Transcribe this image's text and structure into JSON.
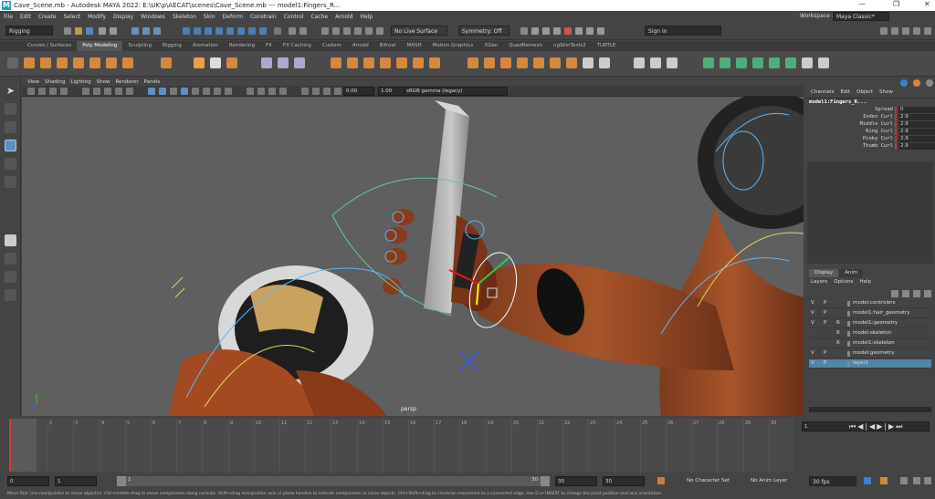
{
  "window": {
    "title": "Cave_Scene.mb - Autodesk MAYA 2022: E:\\UK\\p\\AECAT\\scenes\\Cave_Scene.mb  ---  model1:Fingers_R...",
    "workspace_label": "Workspace :",
    "workspace_value": "Maya Classic*"
  },
  "menu": [
    "File",
    "Edit",
    "Create",
    "Select",
    "Modify",
    "Display",
    "Windows",
    "Skeleton",
    "Skin",
    "Deform",
    "Constrain",
    "Control",
    "Cache",
    "Arnold",
    "Help"
  ],
  "statusline": {
    "menuset": "Rigging",
    "live_surface": "No Live Surface",
    "symmetry": "Symmetry: Off",
    "sign_in": "Sign In"
  },
  "shelf_tabs": [
    "Curves / Surfaces",
    "Poly Modeling",
    "Sculpting",
    "Rigging",
    "Animation",
    "Rendering",
    "FX",
    "FX Caching",
    "Custom",
    "Arnold",
    "Bifrost",
    "MASH",
    "Motion Graphics",
    "XGen",
    "QuadRemesh",
    "ngSkinTools2",
    "TURTLE"
  ],
  "shelf_active": "Poly Modeling",
  "panel_menu": [
    "View",
    "Shading",
    "Lighting",
    "Show",
    "Renderer",
    "Panels"
  ],
  "panel_toolbar": {
    "exposure": "0.00",
    "gamma": "1.00",
    "colorspace": "sRGB gamma (legacy)"
  },
  "viewport": {
    "camera_label": "persp"
  },
  "channelbox": {
    "menu": [
      "Channels",
      "Edit",
      "Object",
      "Show"
    ],
    "node": "model1:Fingers_R...",
    "channels": [
      {
        "name": "Spread",
        "value": "0"
      },
      {
        "name": "Index Curl",
        "value": "2.9"
      },
      {
        "name": "Middle Curl",
        "value": "2.9"
      },
      {
        "name": "Ring Curl",
        "value": "2.9"
      },
      {
        "name": "Pinky Curl",
        "value": "2.9"
      },
      {
        "name": "Thumb Curl",
        "value": "2.9"
      }
    ]
  },
  "layers": {
    "tabs": [
      "Display",
      "Anim"
    ],
    "menu": [
      "Layers",
      "Options",
      "Help"
    ],
    "rows": [
      {
        "v": "V",
        "p": "P",
        "r": "",
        "name": "model:controlers",
        "selected": false
      },
      {
        "v": "V",
        "p": "P",
        "r": "",
        "name": "model1:hair_geometry",
        "selected": false
      },
      {
        "v": "V",
        "p": "P",
        "r": "R",
        "name": "model1:geometry",
        "selected": false
      },
      {
        "v": "",
        "p": "",
        "r": "R",
        "name": "model:skeleton",
        "selected": false
      },
      {
        "v": "",
        "p": "",
        "r": "R",
        "name": "model1:skeleton",
        "selected": false
      },
      {
        "v": "V",
        "p": "P",
        "r": "",
        "name": "model:geometry",
        "selected": false
      },
      {
        "v": "V",
        "p": "P",
        "r": "",
        "name": "layer1",
        "selected": true
      }
    ]
  },
  "timeslider": {
    "ticks": [
      "1",
      "2",
      "3",
      "4",
      "5",
      "6",
      "7",
      "8",
      "9",
      "10",
      "11",
      "12",
      "13",
      "14",
      "15",
      "16",
      "17",
      "18",
      "19",
      "20",
      "21",
      "22",
      "23",
      "24",
      "25",
      "26",
      "27",
      "28",
      "29",
      "30"
    ],
    "current_frame": "1"
  },
  "rangeslider": {
    "start": "0",
    "range_start": "1",
    "slider_start": "1",
    "slider_end": "30",
    "range_end": "30",
    "end": "30",
    "char_set": "No Character Set",
    "anim_layer": "No Anim Layer",
    "fps": "30 fps"
  },
  "helpline": "Move Tool: Use manipulator to move object(s). Ctrl+middle-drag to move components along normals. Shift+drag manipulator axis or plane handles to extrude components or clone objects. Ctrl+Shift+drag to constrain movement to a connected edge. Use D or INSERT to change the pivot position and axis orientation."
}
